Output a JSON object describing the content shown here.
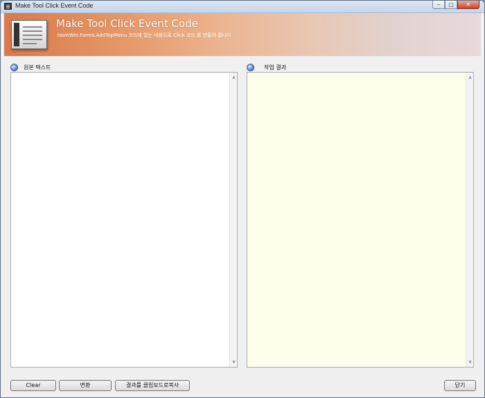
{
  "window": {
    "title": "Make Tool Click Event Code"
  },
  "banner": {
    "title": "Make Tool Click Event Code",
    "subtitle": "iasmWin.Forms.AddTopMenu 코드에 있는 내용으로 Click 코드 를 만들어 줍니다"
  },
  "source": {
    "label": "원본 텍스트",
    "value": ""
  },
  "result": {
    "label": "작업 결과",
    "value": "",
    "background": "#fefeec"
  },
  "buttons": {
    "clear": "Clear",
    "convert": "변환",
    "copy": "결과를 클립보드로복사",
    "close": "닫기"
  },
  "icons": {
    "app": "app-icon",
    "section": "info-bullet-icon",
    "banner": "document-icon"
  }
}
